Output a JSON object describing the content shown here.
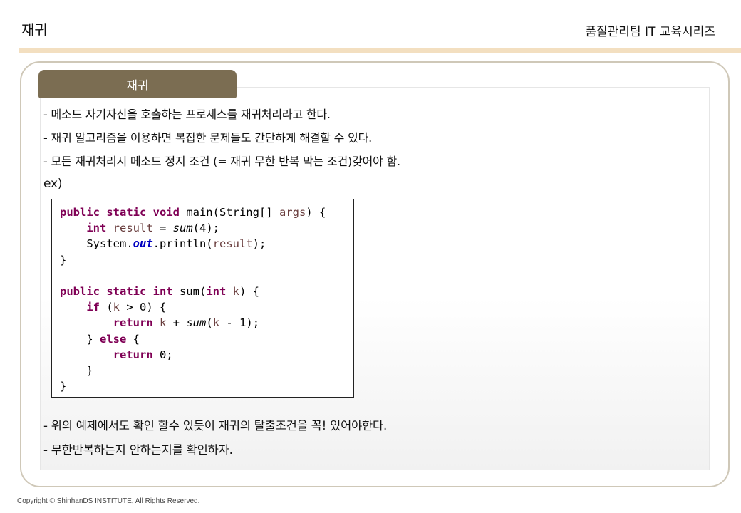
{
  "header": {
    "title": "재귀",
    "series": "품질관리팀 IT 교육시리즈"
  },
  "section": {
    "tab_label": "재귀",
    "bullets": [
      "- 메소드 자기자신을 호출하는 프로세스를 재귀처리라고 한다.",
      "- 재귀 알고리즘을 이용하면 복잡한 문제들도 간단하게 해결할 수 있다.",
      "- 모든 재귀처리시 메소드 정지 조건 (= 재귀 무한 반복 막는 조건)갖어야 함.",
      "ex)"
    ],
    "code": {
      "l1": {
        "a": "public static void",
        "b": " main(String[] ",
        "c": "args",
        "d": ") {"
      },
      "l2": {
        "indent": "    ",
        "a": "int",
        "b": " ",
        "c": "result",
        "d": " = ",
        "e": "sum",
        "f": "(4);"
      },
      "l3": {
        "indent": "    ",
        "a": "System.",
        "b": "out",
        "c": ".println(",
        "d": "result",
        "e": ");"
      },
      "l4": "}",
      "l5": "",
      "l6": {
        "a": "public static int",
        "b": " sum(",
        "c": "int",
        "d": " ",
        "e": "k",
        "f": ") {"
      },
      "l7": {
        "indent": "    ",
        "a": "if",
        "b": " (",
        "c": "k",
        "d": " > 0) {"
      },
      "l8": {
        "indent": "        ",
        "a": "return",
        "b": " ",
        "c": "k",
        "d": " + ",
        "e": "sum",
        "f": "(",
        "g": "k",
        "h": " - 1);"
      },
      "l9": {
        "indent": "    ",
        "a": "} ",
        "b": "else",
        "c": " {"
      },
      "l10": {
        "indent": "        ",
        "a": "return",
        "b": " 0;"
      },
      "l11": "    }",
      "l12": "}"
    },
    "notes": [
      "- 위의 예제에서도 확인 할수 있듯이 재귀의 탈출조건을 꼭! 있어야한다.",
      "- 무한반복하는지 안하는지를 확인하자."
    ]
  },
  "footer": {
    "copyright": "Copyright © ShinhanDS INSTITUTE, All Rights Reserved."
  },
  "colors": {
    "tab_background": "#7b6d52",
    "header_bar": "#f3dfc0",
    "keyword": "#7f0055",
    "variable": "#6a3e3e",
    "static_field": "#0000c0"
  }
}
